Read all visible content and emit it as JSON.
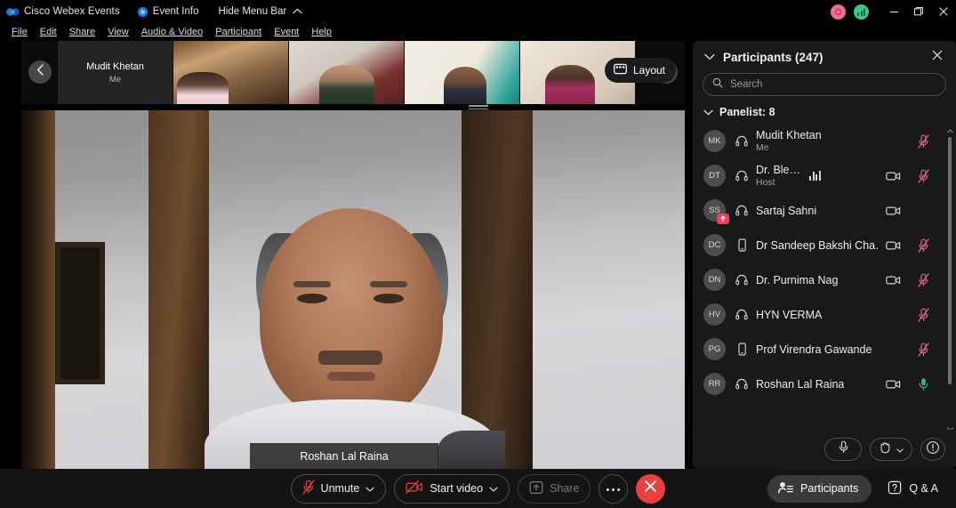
{
  "titlebar": {
    "app_name": "Cisco Webex Events",
    "event_info": "Event Info",
    "hide_menu_bar": "Hide Menu Bar",
    "logo_icon": "webex-logo-icon",
    "event_info_icon": "event-info-dot-icon",
    "record_indicator_icon": "recording-indicator-icon",
    "signal_indicator_icon": "network-signal-icon",
    "minimize_icon": "minimize-icon",
    "maximize_icon": "maximize-restore-icon",
    "close_icon": "close-icon"
  },
  "menubar": {
    "items": [
      {
        "label": "File"
      },
      {
        "label": "Edit"
      },
      {
        "label": "Share"
      },
      {
        "label": "View"
      },
      {
        "label": "Audio & Video"
      },
      {
        "label": "Participant"
      },
      {
        "label": "Event"
      },
      {
        "label": "Help"
      }
    ]
  },
  "filmstrip": {
    "prev_icon": "chevron-left-icon",
    "next_icon": "chevron-right-icon",
    "layout_label": "Layout",
    "layout_icon": "layout-grid-icon",
    "self_thumb": {
      "name": "Mudit Khetan",
      "role": "Me"
    },
    "drag_handle_name": "filmstrip-resize-handle"
  },
  "stage": {
    "active_speaker_name": "Roshan Lal Raina"
  },
  "panel": {
    "title": "Participants (247)",
    "collapse_icon": "chevron-down-icon",
    "close_icon": "close-icon",
    "search": {
      "placeholder": "Search",
      "value": "",
      "icon": "search-icon"
    },
    "group_header": "Panelist: 8",
    "group_collapse_icon": "chevron-down-icon",
    "participants": [
      {
        "initials": "MK",
        "name": "Mudit Khetan",
        "role": "Me",
        "device_icon": "headset-icon",
        "video_icon": "",
        "mic_icon": "mic-muted-icon",
        "mic_state": "muted",
        "badge": "",
        "audio_bars": false
      },
      {
        "initials": "DT",
        "name": "Dr. Ble…",
        "role": "Host",
        "device_icon": "headset-icon",
        "video_icon": "video-camera-icon",
        "mic_icon": "mic-muted-icon",
        "mic_state": "muted",
        "badge": "",
        "audio_bars": true
      },
      {
        "initials": "SS",
        "name": "Sartaj Sahni",
        "role": "",
        "device_icon": "headset-icon",
        "video_icon": "video-camera-icon",
        "mic_icon": "",
        "mic_state": "none",
        "badge": "raise-hand-badge",
        "audio_bars": false
      },
      {
        "initials": "DC",
        "name": "Dr Sandeep Bakshi Cha…",
        "role": "",
        "device_icon": "mobile-phone-icon",
        "video_icon": "video-camera-icon",
        "mic_icon": "mic-muted-icon",
        "mic_state": "muted",
        "badge": "",
        "audio_bars": false
      },
      {
        "initials": "DN",
        "name": "Dr. Purnima Nag",
        "role": "",
        "device_icon": "headset-icon",
        "video_icon": "video-camera-icon",
        "mic_icon": "mic-muted-icon",
        "mic_state": "muted",
        "badge": "",
        "audio_bars": false
      },
      {
        "initials": "HV",
        "name": "HYN VERMA",
        "role": "",
        "device_icon": "headset-icon",
        "video_icon": "",
        "mic_icon": "mic-muted-icon",
        "mic_state": "muted",
        "badge": "",
        "audio_bars": false
      },
      {
        "initials": "PG",
        "name": "Prof Virendra Gawande",
        "role": "",
        "device_icon": "mobile-phone-icon",
        "video_icon": "",
        "mic_icon": "mic-muted-icon",
        "mic_state": "muted",
        "badge": "",
        "audio_bars": false
      },
      {
        "initials": "RR",
        "name": "Roshan Lal Raina",
        "role": "",
        "device_icon": "headset-icon",
        "video_icon": "video-camera-icon",
        "mic_icon": "mic-active-icon",
        "mic_state": "active",
        "badge": "",
        "audio_bars": false
      }
    ],
    "footer": {
      "mute_all_icon": "mic-icon",
      "raise_hand_icon": "raise-hand-icon",
      "raise_hand_chevron_icon": "chevron-down-icon",
      "info_icon": "info-circle-icon"
    },
    "scrollbar": {
      "up_icon": "chevron-up-icon",
      "down_icon": "chevron-down-icon"
    }
  },
  "bottombar": {
    "unmute": {
      "label": "Unmute",
      "icon": "mic-muted-icon",
      "chevron": "chevron-down-icon"
    },
    "start_video": {
      "label": "Start video",
      "icon": "video-off-icon",
      "chevron": "chevron-down-icon"
    },
    "share": {
      "label": "Share",
      "icon": "share-screen-icon",
      "disabled": true
    },
    "more": {
      "icon": "more-options-icon"
    },
    "end": {
      "icon": "end-call-icon"
    },
    "participants": {
      "label": "Participants",
      "icon": "participants-icon"
    },
    "qa": {
      "label": "Q & A",
      "icon": "question-mark-icon"
    }
  },
  "colors": {
    "accent_red": "#e8413f",
    "mic_muted_red": "#e06a80",
    "mic_active_green": "#3fae7a",
    "panel_bg": "#191919",
    "badge_red": "#e8415f",
    "record_pink": "#ef6d8e",
    "signal_green": "#3ec98a",
    "event_blue": "#1a7fe0"
  }
}
